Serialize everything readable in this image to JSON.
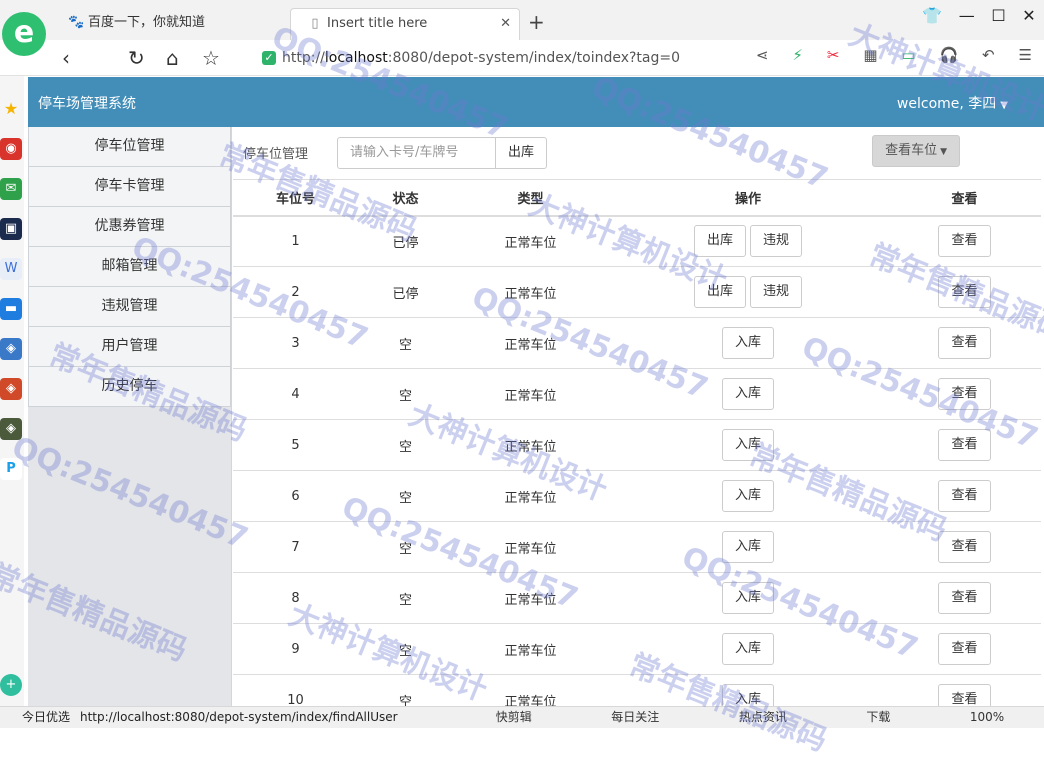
{
  "browser": {
    "tabs": [
      {
        "label": "百度一下，你就知道",
        "icon": "paw-icon"
      },
      {
        "label": "Insert title here",
        "icon": "page-icon"
      }
    ],
    "new_tab": "+",
    "url_prefix": "http://",
    "url_host": "localhost",
    "url_rest": ":8080/depot-system/index/toindex?tag=0",
    "status_left": "今日优选",
    "status_url": "http://localhost:8080/depot-system/index/findAllUser",
    "status_items": [
      "快剪辑",
      "每日关注",
      "热点资讯",
      "下载",
      "100%"
    ],
    "accent_color": "#438eb9"
  },
  "app": {
    "brand": "停车场管理系统",
    "user": "welcome, 李四"
  },
  "sidebar": {
    "items": [
      {
        "label": "停车位管理"
      },
      {
        "label": "停车卡管理"
      },
      {
        "label": "优惠券管理"
      },
      {
        "label": "邮箱管理"
      },
      {
        "label": "违规管理"
      },
      {
        "label": "用户管理"
      },
      {
        "label": "历史停车"
      }
    ]
  },
  "toolbar": {
    "breadcrumb": "停车位管理",
    "search_placeholder": "请输入卡号/车牌号",
    "search_button": "出库",
    "view_button": "查看车位"
  },
  "table": {
    "headers": [
      "车位号",
      "状态",
      "类型",
      "操作",
      "查看"
    ],
    "rows": [
      {
        "no": "1",
        "status": "已停",
        "type": "正常车位",
        "actions": [
          "出库",
          "违规"
        ],
        "view": "查看"
      },
      {
        "no": "2",
        "status": "已停",
        "type": "正常车位",
        "actions": [
          "出库",
          "违规"
        ],
        "view": "查看"
      },
      {
        "no": "3",
        "status": "空",
        "type": "正常车位",
        "actions": [
          "入库"
        ],
        "view": "查看"
      },
      {
        "no": "4",
        "status": "空",
        "type": "正常车位",
        "actions": [
          "入库"
        ],
        "view": "查看"
      },
      {
        "no": "5",
        "status": "空",
        "type": "正常车位",
        "actions": [
          "入库"
        ],
        "view": "查看"
      },
      {
        "no": "6",
        "status": "空",
        "type": "正常车位",
        "actions": [
          "入库"
        ],
        "view": "查看"
      },
      {
        "no": "7",
        "status": "空",
        "type": "正常车位",
        "actions": [
          "入库"
        ],
        "view": "查看"
      },
      {
        "no": "8",
        "status": "空",
        "type": "正常车位",
        "actions": [
          "入库"
        ],
        "view": "查看"
      },
      {
        "no": "9",
        "status": "空",
        "type": "正常车位",
        "actions": [
          "入库"
        ],
        "view": "查看"
      },
      {
        "no": "10",
        "status": "空",
        "type": "正常车位",
        "actions": [
          "入库"
        ],
        "view": "查看"
      }
    ]
  },
  "watermarks": [
    "QQ:254540457",
    "常年售精品源码",
    "大神计算机设计"
  ]
}
